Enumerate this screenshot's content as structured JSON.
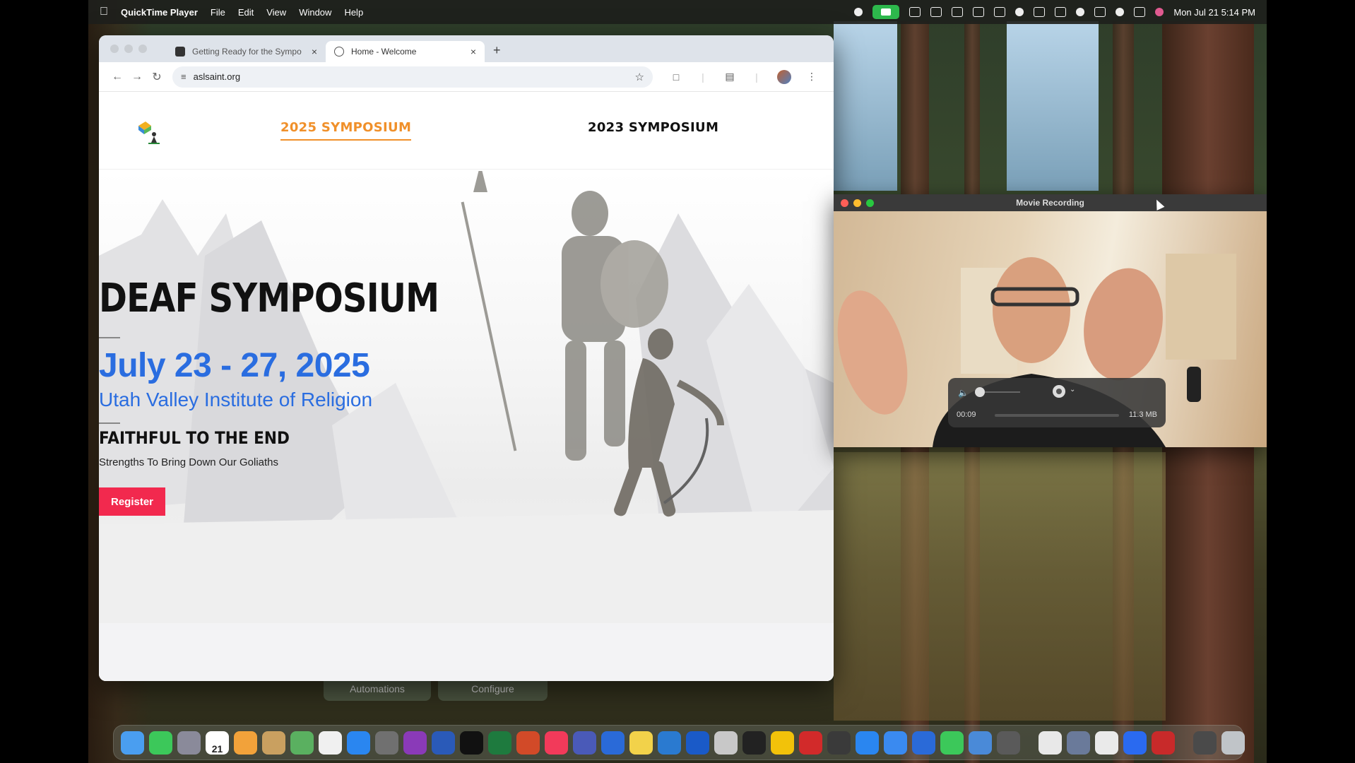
{
  "menubar": {
    "app_name": "QuickTime Player",
    "menus": [
      "File",
      "Edit",
      "View",
      "Window",
      "Help"
    ],
    "clock": "Mon Jul 21  5:14 PM"
  },
  "browser": {
    "tabs": [
      {
        "label": "Getting Ready for the Sympo",
        "active": false
      },
      {
        "label": "Home - Welcome",
        "active": true
      }
    ],
    "url": "aslsaint.org"
  },
  "site": {
    "nav": {
      "link_2025": "2025 SYMPOSIUM",
      "link_2023": "2023 SYMPOSIUM"
    },
    "hero": {
      "title": "DEAF SYMPOSIUM",
      "date": "July 23 - 27, 2025",
      "venue": "Utah Valley Institute of Religion",
      "theme": "FAITHFUL TO THE END",
      "subtitle": "Strengths To Bring Down Our Goliaths",
      "register_label": "Register"
    }
  },
  "behind_window": {
    "automations_label": "Automations",
    "configure_label": "Configure"
  },
  "quicktime": {
    "title": "Movie Recording",
    "elapsed": "00:09",
    "file_size": "11.3 MB"
  },
  "dock": {
    "icons": [
      "finder-icon",
      "facetime-icon",
      "launchpad-icon",
      "calendar-icon",
      "photos-icon",
      "notes-icon",
      "maps-icon",
      "reminders-icon",
      "app-store-icon",
      "system-settings-icon",
      "onenote-icon",
      "word-icon",
      "apple-tv-icon",
      "excel-icon",
      "powerpoint-icon",
      "music-icon",
      "teams-icon",
      "defender-icon",
      "notes-app-icon",
      "accessibility-icon",
      "paypal-icon",
      "tool-icon",
      "sketchup-icon",
      "quip-icon",
      "calculator-icon",
      "mail-icon",
      "tasks-icon",
      "safari-icon",
      "todo-icon",
      "messages-icon",
      "preview-icon",
      "quicktime-icon",
      "chrome-icon",
      "finder-window-icon",
      "home-icon",
      "zoom-icon",
      "acrobat-icon",
      "printer-icon",
      "trash-icon"
    ],
    "calendar_day": "21"
  }
}
